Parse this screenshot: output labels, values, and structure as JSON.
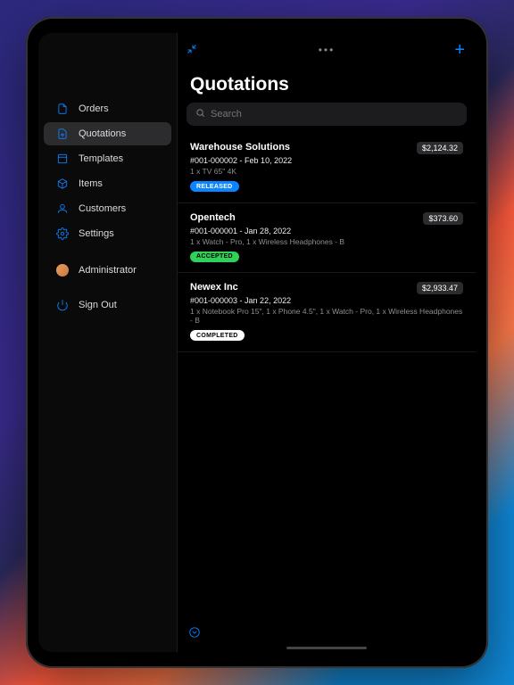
{
  "page": {
    "title": "Quotations"
  },
  "search": {
    "placeholder": "Search"
  },
  "sidebar": {
    "items": [
      {
        "label": "Orders"
      },
      {
        "label": "Quotations"
      },
      {
        "label": "Templates"
      },
      {
        "label": "Items"
      },
      {
        "label": "Customers"
      },
      {
        "label": "Settings"
      }
    ],
    "user": "Administrator",
    "signout": "Sign Out"
  },
  "quotations": [
    {
      "company": "Warehouse Solutions",
      "ref": "#001-000002 - Feb 10, 2022",
      "desc": "1 x TV 65\" 4K",
      "price": "$2,124.32",
      "status": "RELEASED",
      "status_class": "released"
    },
    {
      "company": "Opentech",
      "ref": "#001-000001 - Jan 28, 2022",
      "desc": "1 x Watch - Pro, 1 x Wireless Headphones - B",
      "price": "$373.60",
      "status": "ACCEPTED",
      "status_class": "accepted"
    },
    {
      "company": "Newex Inc",
      "ref": "#001-000003 - Jan 22, 2022",
      "desc": "1 x Notebook Pro 15\", 1 x Phone 4.5\", 1 x Watch - Pro, 1 x Wireless Headphones - B",
      "price": "$2,933.47",
      "status": "COMPLETED",
      "status_class": "completed"
    }
  ]
}
